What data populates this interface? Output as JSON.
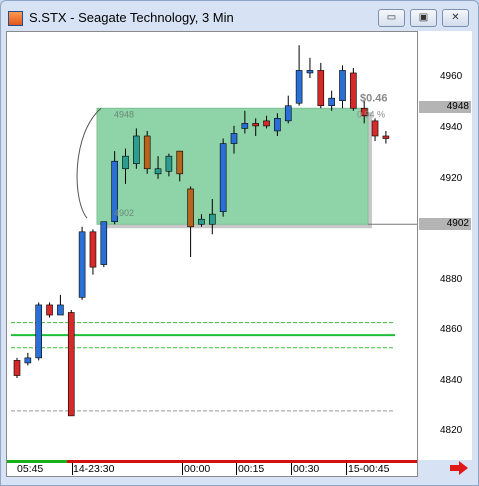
{
  "window": {
    "title": "S.STX - Seagate Technology, 3 Min",
    "buttons": {
      "minimize": "▭",
      "restore": "▣",
      "close": "✕"
    }
  },
  "colors": {
    "up_candle": "#2a6fd6",
    "down_candle": "#d42a2a",
    "alt_down_candle": "#b5651d",
    "alt_up_candle": "#2a9d8f",
    "box_fill": "#8fd3a8",
    "support_line": "#1fbf3a",
    "dashed_line": "#3cbf3a",
    "axis_tag": "#b4b4b4"
  },
  "y_axis": {
    "ticks": [
      "4960",
      "4940",
      "4920",
      "4880",
      "4860",
      "4840",
      "4820"
    ],
    "tags": [
      "4948",
      "4902"
    ]
  },
  "x_axis": {
    "labels": [
      "05:45",
      "14-23:30",
      "00:00",
      "00:15",
      "00:30",
      "15-00:45"
    ]
  },
  "range_box": {
    "top_label": "4948",
    "bottom_label": "4902",
    "change": "$0.46",
    "percent": "0.94 %"
  },
  "chart_data": {
    "type": "candlestick",
    "title": "S.STX - Seagate Technology, 3 Min",
    "y_ticks": [
      4960,
      4940,
      4920,
      4880,
      4860,
      4840,
      4820
    ],
    "candles": [
      {
        "o": 4848,
        "c": 4842,
        "h": 4849,
        "l": 4841
      },
      {
        "o": 4847,
        "c": 4849,
        "h": 4851,
        "l": 4846
      },
      {
        "o": 4849,
        "c": 4870,
        "h": 4871,
        "l": 4848
      },
      {
        "o": 4870,
        "c": 4866,
        "h": 4871,
        "l": 4865
      },
      {
        "o": 4866,
        "c": 4870,
        "h": 4874,
        "l": 4866
      },
      {
        "o": 4867,
        "c": 4826,
        "h": 4868,
        "l": 4826
      },
      {
        "o": 4873,
        "c": 4899,
        "h": 4901,
        "l": 4872
      },
      {
        "o": 4899,
        "c": 4885,
        "h": 4900,
        "l": 4882
      },
      {
        "o": 4886,
        "c": 4903,
        "h": 4903,
        "l": 4885
      },
      {
        "o": 4903,
        "c": 4927,
        "h": 4931,
        "l": 4902
      },
      {
        "o": 4924,
        "c": 4929,
        "h": 4932,
        "l": 4918
      },
      {
        "o": 4926,
        "c": 4937,
        "h": 4940,
        "l": 4924
      },
      {
        "o": 4937,
        "c": 4924,
        "h": 4939,
        "l": 4922
      },
      {
        "o": 4922,
        "c": 4924,
        "h": 4929,
        "l": 4920
      },
      {
        "o": 4923,
        "c": 4929,
        "h": 4930,
        "l": 4921
      },
      {
        "o": 4931,
        "c": 4922,
        "h": 4931,
        "l": 4919
      },
      {
        "o": 4916,
        "c": 4901,
        "h": 4917,
        "l": 4889
      },
      {
        "o": 4902,
        "c": 4904,
        "h": 4906,
        "l": 4901
      },
      {
        "o": 4902,
        "c": 4906,
        "h": 4912,
        "l": 4898
      },
      {
        "o": 4907,
        "c": 4934,
        "h": 4936,
        "l": 4905
      },
      {
        "o": 4934,
        "c": 4938,
        "h": 4941,
        "l": 4930
      },
      {
        "o": 4940,
        "c": 4942,
        "h": 4947,
        "l": 4938
      },
      {
        "o": 4942,
        "c": 4941,
        "h": 4944,
        "l": 4937
      },
      {
        "o": 4943,
        "c": 4941,
        "h": 4945,
        "l": 4940
      },
      {
        "o": 4939,
        "c": 4944,
        "h": 4946,
        "l": 4937
      },
      {
        "o": 4943,
        "c": 4949,
        "h": 4953,
        "l": 4942
      },
      {
        "o": 4950,
        "c": 4963,
        "h": 4973,
        "l": 4949
      },
      {
        "o": 4962,
        "c": 4963,
        "h": 4968,
        "l": 4960
      },
      {
        "o": 4963,
        "c": 4949,
        "h": 4966,
        "l": 4948
      },
      {
        "o": 4949,
        "c": 4952,
        "h": 4955,
        "l": 4947
      },
      {
        "o": 4951,
        "c": 4963,
        "h": 4965,
        "l": 4948
      },
      {
        "o": 4962,
        "c": 4948,
        "h": 4964,
        "l": 4947
      },
      {
        "o": 4948,
        "c": 4945,
        "h": 4951,
        "l": 4942
      },
      {
        "o": 4943,
        "c": 4937,
        "h": 4944,
        "l": 4935
      },
      {
        "o": 4937,
        "c": 4936,
        "h": 4939,
        "l": 4934
      }
    ],
    "box": {
      "upper": 4948,
      "lower": 4902
    },
    "levels": {
      "solid": 4858,
      "dashed": [
        4863,
        4853
      ],
      "bottom_dashed": 4828,
      "ref_line": 4902
    }
  }
}
